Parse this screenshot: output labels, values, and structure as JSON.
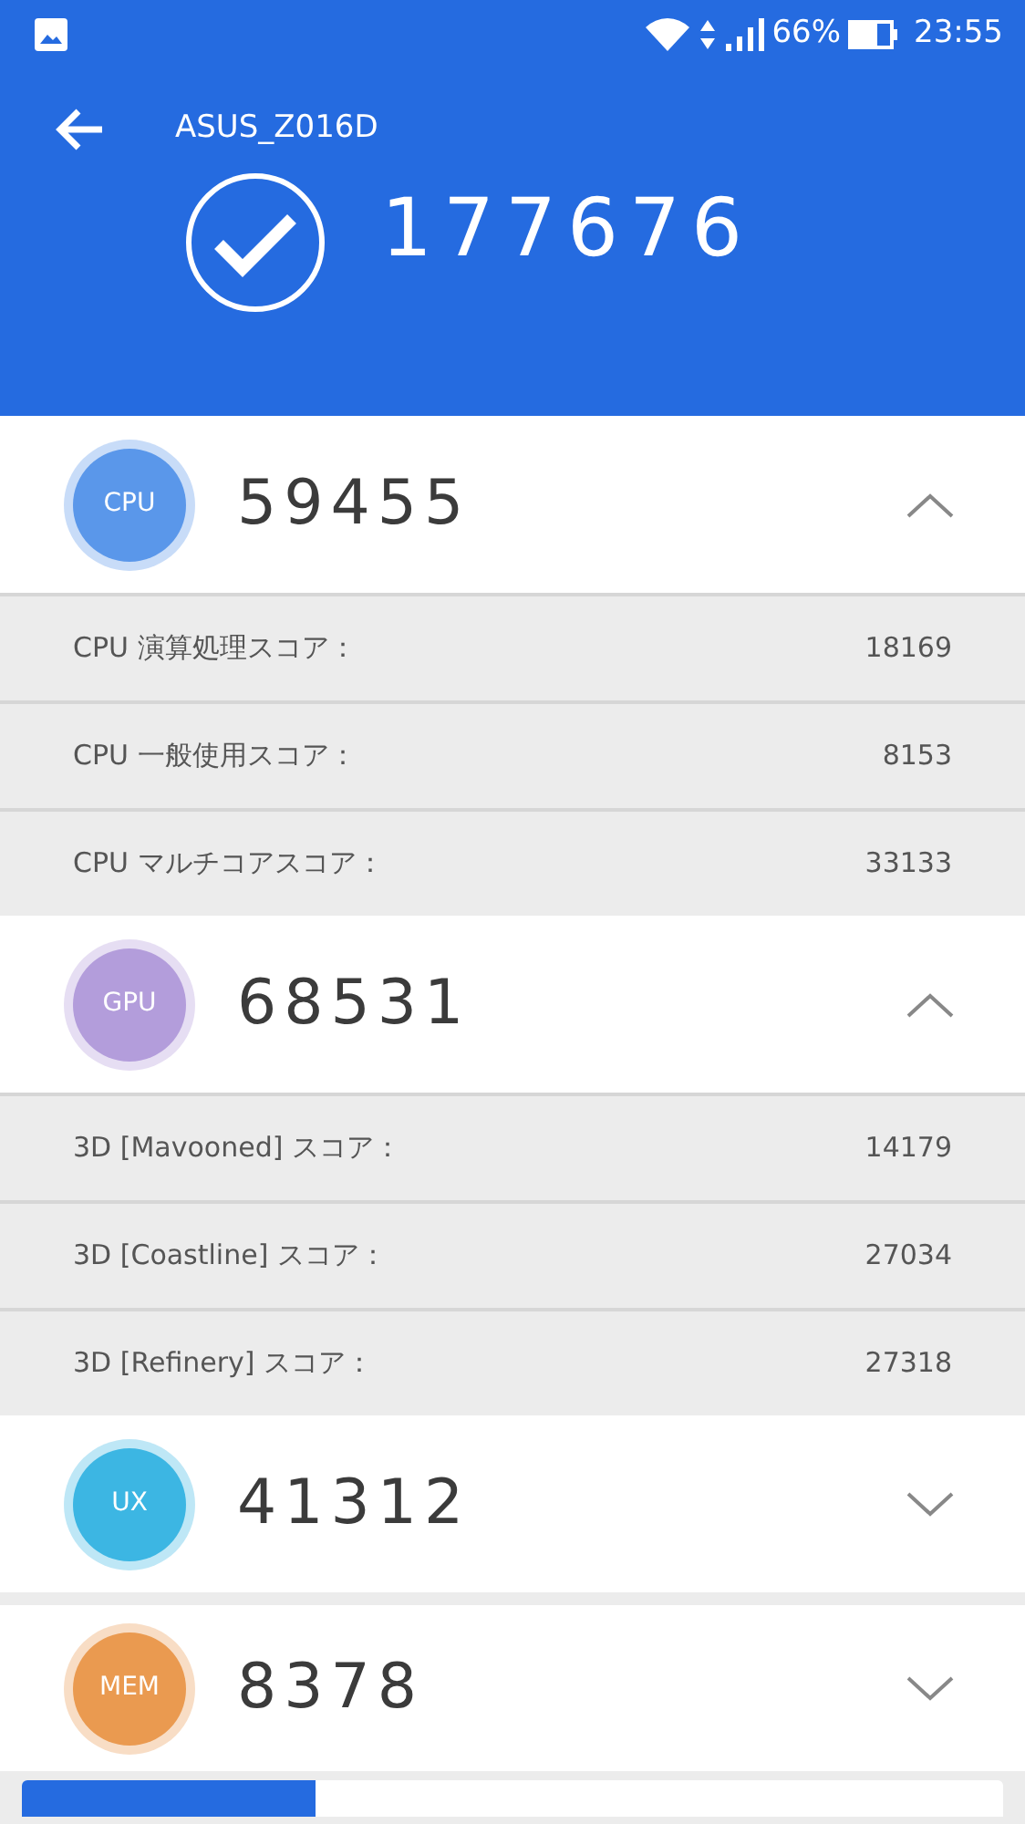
{
  "status_bar": {
    "battery_text": "66%",
    "time": "23:55"
  },
  "header": {
    "title": "ASUS_Z016D",
    "total_score": "177676"
  },
  "sections": [
    {
      "badge": "CPU",
      "color": "#5a97ea",
      "score": "59455",
      "expanded": true,
      "rows": [
        {
          "label": "CPU 演算処理スコア：",
          "value": "18169"
        },
        {
          "label": "CPU 一般使用スコア：",
          "value": "8153"
        },
        {
          "label": "CPU マルチコアスコア：",
          "value": "33133"
        }
      ]
    },
    {
      "badge": "GPU",
      "color": "#b39ddb",
      "score": "68531",
      "expanded": true,
      "rows": [
        {
          "label": "3D [Mavooned] スコア：",
          "value": "14179"
        },
        {
          "label": "3D [Coastline] スコア：",
          "value": "27034"
        },
        {
          "label": "3D [Refinery] スコア：",
          "value": "27318"
        }
      ]
    },
    {
      "badge": "UX",
      "color": "#3cb6e3",
      "score": "41312",
      "expanded": false
    },
    {
      "badge": "MEM",
      "color": "#ea9a50",
      "score": "8378",
      "expanded": false
    }
  ],
  "bottom_bar": {
    "level": 0.3
  }
}
